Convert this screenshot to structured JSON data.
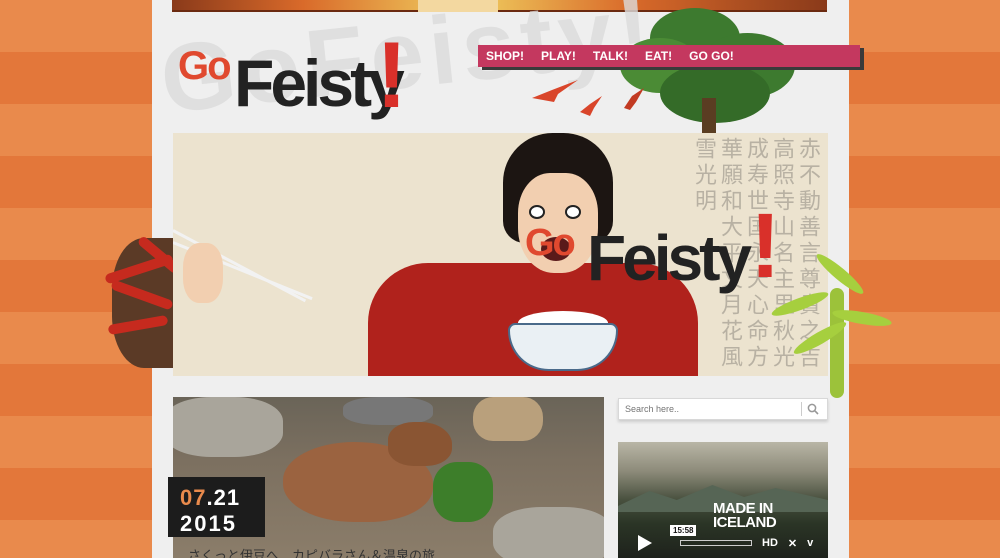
{
  "brand": {
    "go": "Go",
    "feisty": "Feisty",
    "bang": "!",
    "watermark": "GoFeisty!"
  },
  "nav": {
    "items": [
      {
        "label": "SHOP!"
      },
      {
        "label": "PLAY!"
      },
      {
        "label": "TALK!"
      },
      {
        "label": "EAT!"
      },
      {
        "label": "GO GO!"
      }
    ]
  },
  "hero": {
    "background_glyphs": "赤不動善言尊貴之吉高照寺山名主里秋光成寿世国永天心命方華願和大平文月花風雪光明"
  },
  "post": {
    "date_month": "07",
    "date_day": ".21",
    "date_year": "2015",
    "title": "さくっと伊豆へ…カピバラさん＆温泉の旅"
  },
  "sidebar": {
    "search_placeholder": "Search here..",
    "video": {
      "title_line1": "MADE IN",
      "title_line2": "ICELAND",
      "duration": "15:58",
      "hd_label": "HD",
      "vimeo_label": "v"
    }
  },
  "colors": {
    "accent_orange": "#e98a4c",
    "nav_pink": "#c4385f",
    "logo_red": "#e0492f"
  }
}
